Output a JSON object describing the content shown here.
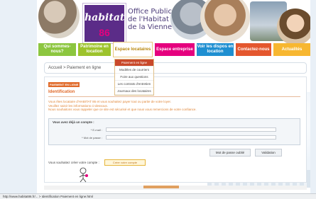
{
  "site": {
    "logo_text": "habitat",
    "logo_number": "86",
    "org_lines": [
      "Office Public",
      "de l'Habitat",
      "de la Vienne"
    ]
  },
  "nav": [
    {
      "label": "Qui sommes-nous?"
    },
    {
      "label": "Patrimoine en location"
    },
    {
      "label": "Espace locataires"
    },
    {
      "label": "Espace entreprise"
    },
    {
      "label": "Voir les dispos en location"
    },
    {
      "label": "Contactez-nous"
    },
    {
      "label": "Actualités"
    }
  ],
  "dropdown": [
    {
      "label": "Paiement en ligne"
    },
    {
      "label": "Modèles de courriers"
    },
    {
      "label": "Foire aux questions"
    },
    {
      "label": "Les contrats d'entretien"
    },
    {
      "label": "Journaux des locataires"
    }
  ],
  "breadcrumb": "Accueil > Paiement en ligne",
  "content": {
    "tag": "PAIEMENT EN LIGNE",
    "section_title": "Identification",
    "intro_lines": [
      "Vous êtes locataire d'HABITAT 86 et vous souhaitez payer tout ou partie de votre loyer.",
      "Veuillez saisir les informations ci-dessous.",
      "Nous souhaitons vous rappeler que ce site est sécurisé et que nous vous remercions de votre confiance."
    ],
    "login_title": "Vous avez déjà un compte :",
    "email_label": "* E-mail :",
    "password_label": "* Mot de passe :",
    "forgot_label": "Mot de passe oublié",
    "validate_label": "Validation",
    "create_label": "Vous souhaitez créer votre compte :",
    "create_button": "Créer votre compte"
  },
  "status": "http://www.habitat86.fr/... > Identification   Paiement en ligne.html"
}
